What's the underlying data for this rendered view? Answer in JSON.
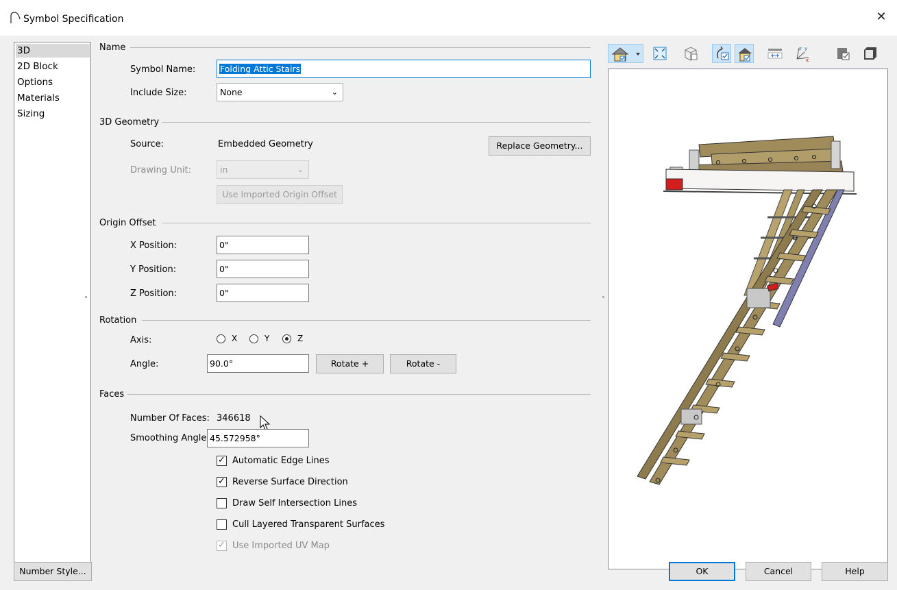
{
  "window": {
    "title": "Symbol Specification",
    "close_label": "✕"
  },
  "nav": {
    "items": [
      "3D",
      "2D Block",
      "Options",
      "Materials",
      "Sizing"
    ],
    "selected": "3D"
  },
  "name_section": {
    "heading": "Name",
    "symbol_name_label": "Symbol Name:",
    "symbol_name_value": "Folding Attic Stairs",
    "include_size_label": "Include Size:",
    "include_size_value": "None"
  },
  "geometry_section": {
    "heading": "3D Geometry",
    "source_label": "Source:",
    "source_value": "Embedded Geometry",
    "replace_button": "Replace Geometry...",
    "drawing_unit_label": "Drawing Unit:",
    "drawing_unit_value": "in",
    "imported_origin_button": "Use Imported Origin Offset"
  },
  "origin_section": {
    "heading": "Origin Offset",
    "x_label": "X Position:",
    "x_value": "0\"",
    "y_label": "Y Position:",
    "y_value": "0\"",
    "z_label": "Z Position:",
    "z_value": "0\""
  },
  "rotation_section": {
    "heading": "Rotation",
    "axis_label": "Axis:",
    "axis_options": [
      "X",
      "Y",
      "Z"
    ],
    "axis_selected": "Z",
    "angle_label": "Angle:",
    "angle_value": "90.0°",
    "rotate_plus": "Rotate +",
    "rotate_minus": "Rotate -"
  },
  "faces_section": {
    "heading": "Faces",
    "num_faces_label": "Number Of Faces:",
    "num_faces_value": "346618",
    "smoothing_label": "Smoothing Angle:",
    "smoothing_value": "45.572958°",
    "options": [
      {
        "label": "Automatic Edge Lines",
        "checked": true,
        "disabled": false
      },
      {
        "label": "Reverse Surface Direction",
        "checked": true,
        "disabled": false
      },
      {
        "label": "Draw Self Intersection Lines",
        "checked": false,
        "disabled": false
      },
      {
        "label": "Cull Layered Transparent Surfaces",
        "checked": false,
        "disabled": false
      },
      {
        "label": "Use Imported UV Map",
        "checked": true,
        "disabled": true
      }
    ]
  },
  "preview_toolbar": {
    "icons": [
      "camera-house-icon",
      "fit-view-icon",
      "wireframe-icon",
      "rotate-check-icon",
      "render-check-icon",
      "pan-icon",
      "axes-icon",
      "object-check-icon",
      "cube-icon"
    ]
  },
  "footer": {
    "number_style_button": "Number Style...",
    "ok_button": "OK",
    "cancel_button": "Cancel",
    "help_button": "Help"
  },
  "colors": {
    "accent": "#0078d7",
    "wood": "#a08c5a",
    "rail": "#7f7fb0",
    "panel": "#ffffff"
  }
}
